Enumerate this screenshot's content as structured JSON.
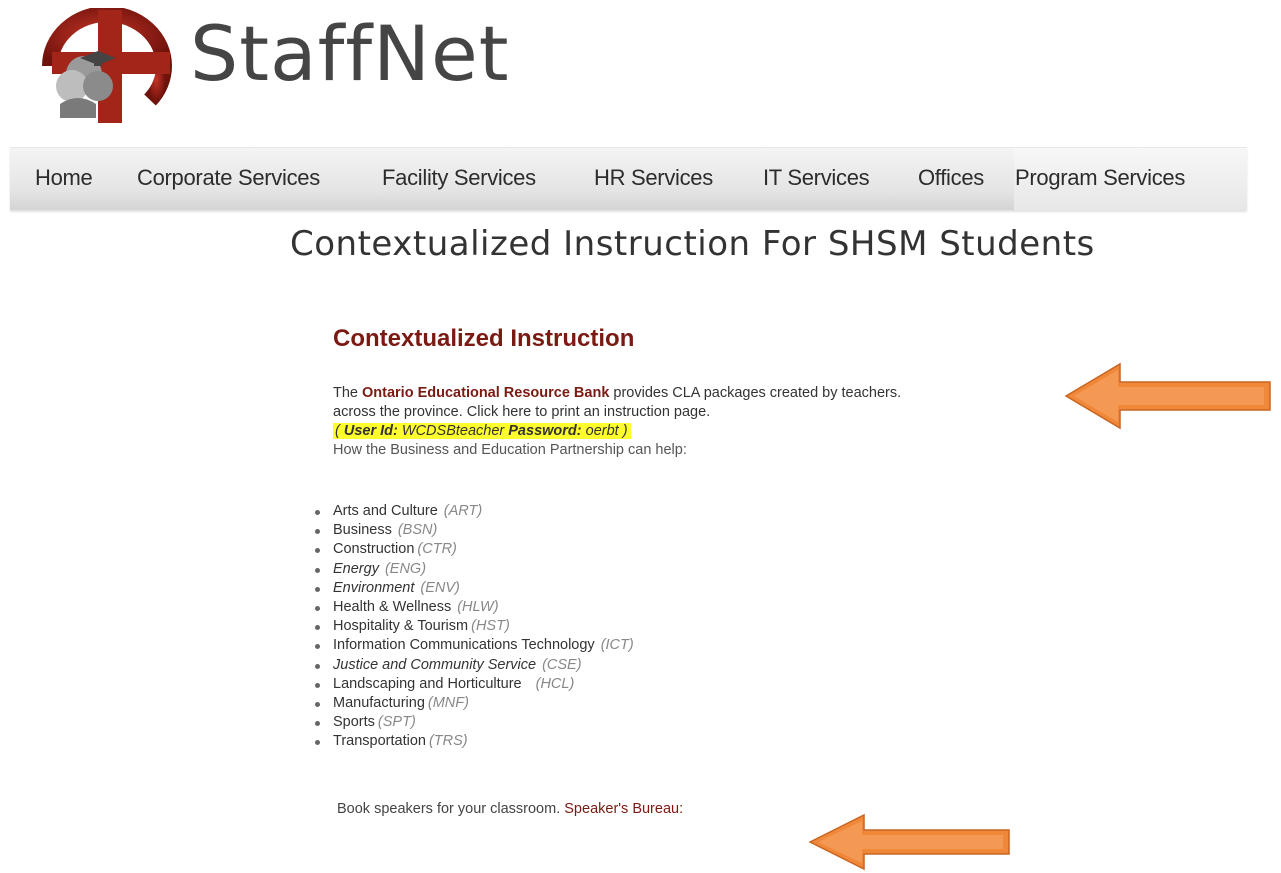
{
  "header": {
    "brand": "StaffNet"
  },
  "nav": {
    "items": [
      {
        "label": "Home"
      },
      {
        "label": "Corporate Services"
      },
      {
        "label": "Facility Services"
      },
      {
        "label": "HR Services"
      },
      {
        "label": "IT Services"
      },
      {
        "label": "Offices"
      },
      {
        "label": "Program Services"
      }
    ]
  },
  "page": {
    "title": "Contextualized Instruction For SHSM Students",
    "section_heading": "Contextualized Instruction",
    "intro_prefix": "The ",
    "resource_bank_link": "Ontario Educational Resource Bank",
    "intro_suffix": " provides CLA packages created by teachers.",
    "intro_line2": "across the province. Click here to print an instruction page.",
    "credentials": {
      "open_paren": "( ",
      "user_label": "User Id:",
      "user_value": " WCDSBteacher ",
      "password_label": "Password:",
      "password_value": " oerbt",
      "close_paren": "  )"
    },
    "partnership_text": "How the Business and Education Partnership can help:",
    "categories": [
      {
        "name": "Arts and Culture",
        "code": "(ART)"
      },
      {
        "name": "Business",
        "code": "(BSN)"
      },
      {
        "name": "Construction",
        "code": "(CTR)"
      },
      {
        "name": "Energy",
        "code": "(ENG)"
      },
      {
        "name": "Environment",
        "code": "(ENV)"
      },
      {
        "name": "Health & Wellness",
        "code": "(HLW)"
      },
      {
        "name": "Hospitality & Tourism",
        "code": "(HST)"
      },
      {
        "name": "Information Communications Technology",
        "code": "(ICT)"
      },
      {
        "name": "Justice and Community Service",
        "code": "(CSE)"
      },
      {
        "name": "Landscaping and Horticulture",
        "code": "(HCL)"
      },
      {
        "name": "Manufacturing",
        "code": "(MNF)"
      },
      {
        "name": "Sports",
        "code": "(SPT)"
      },
      {
        "name": "Transportation",
        "code": "(TRS)"
      }
    ],
    "footer_text": "Book speakers for your classroom. ",
    "speakers_link": "Speaker's Bureau:"
  },
  "colors": {
    "accent": "#7b1a12",
    "highlight": "#ffff2e",
    "arrow": "#f0883a"
  },
  "icons": {
    "logo": "staffnet-logo-icon",
    "arrow": "arrow-left-icon"
  }
}
